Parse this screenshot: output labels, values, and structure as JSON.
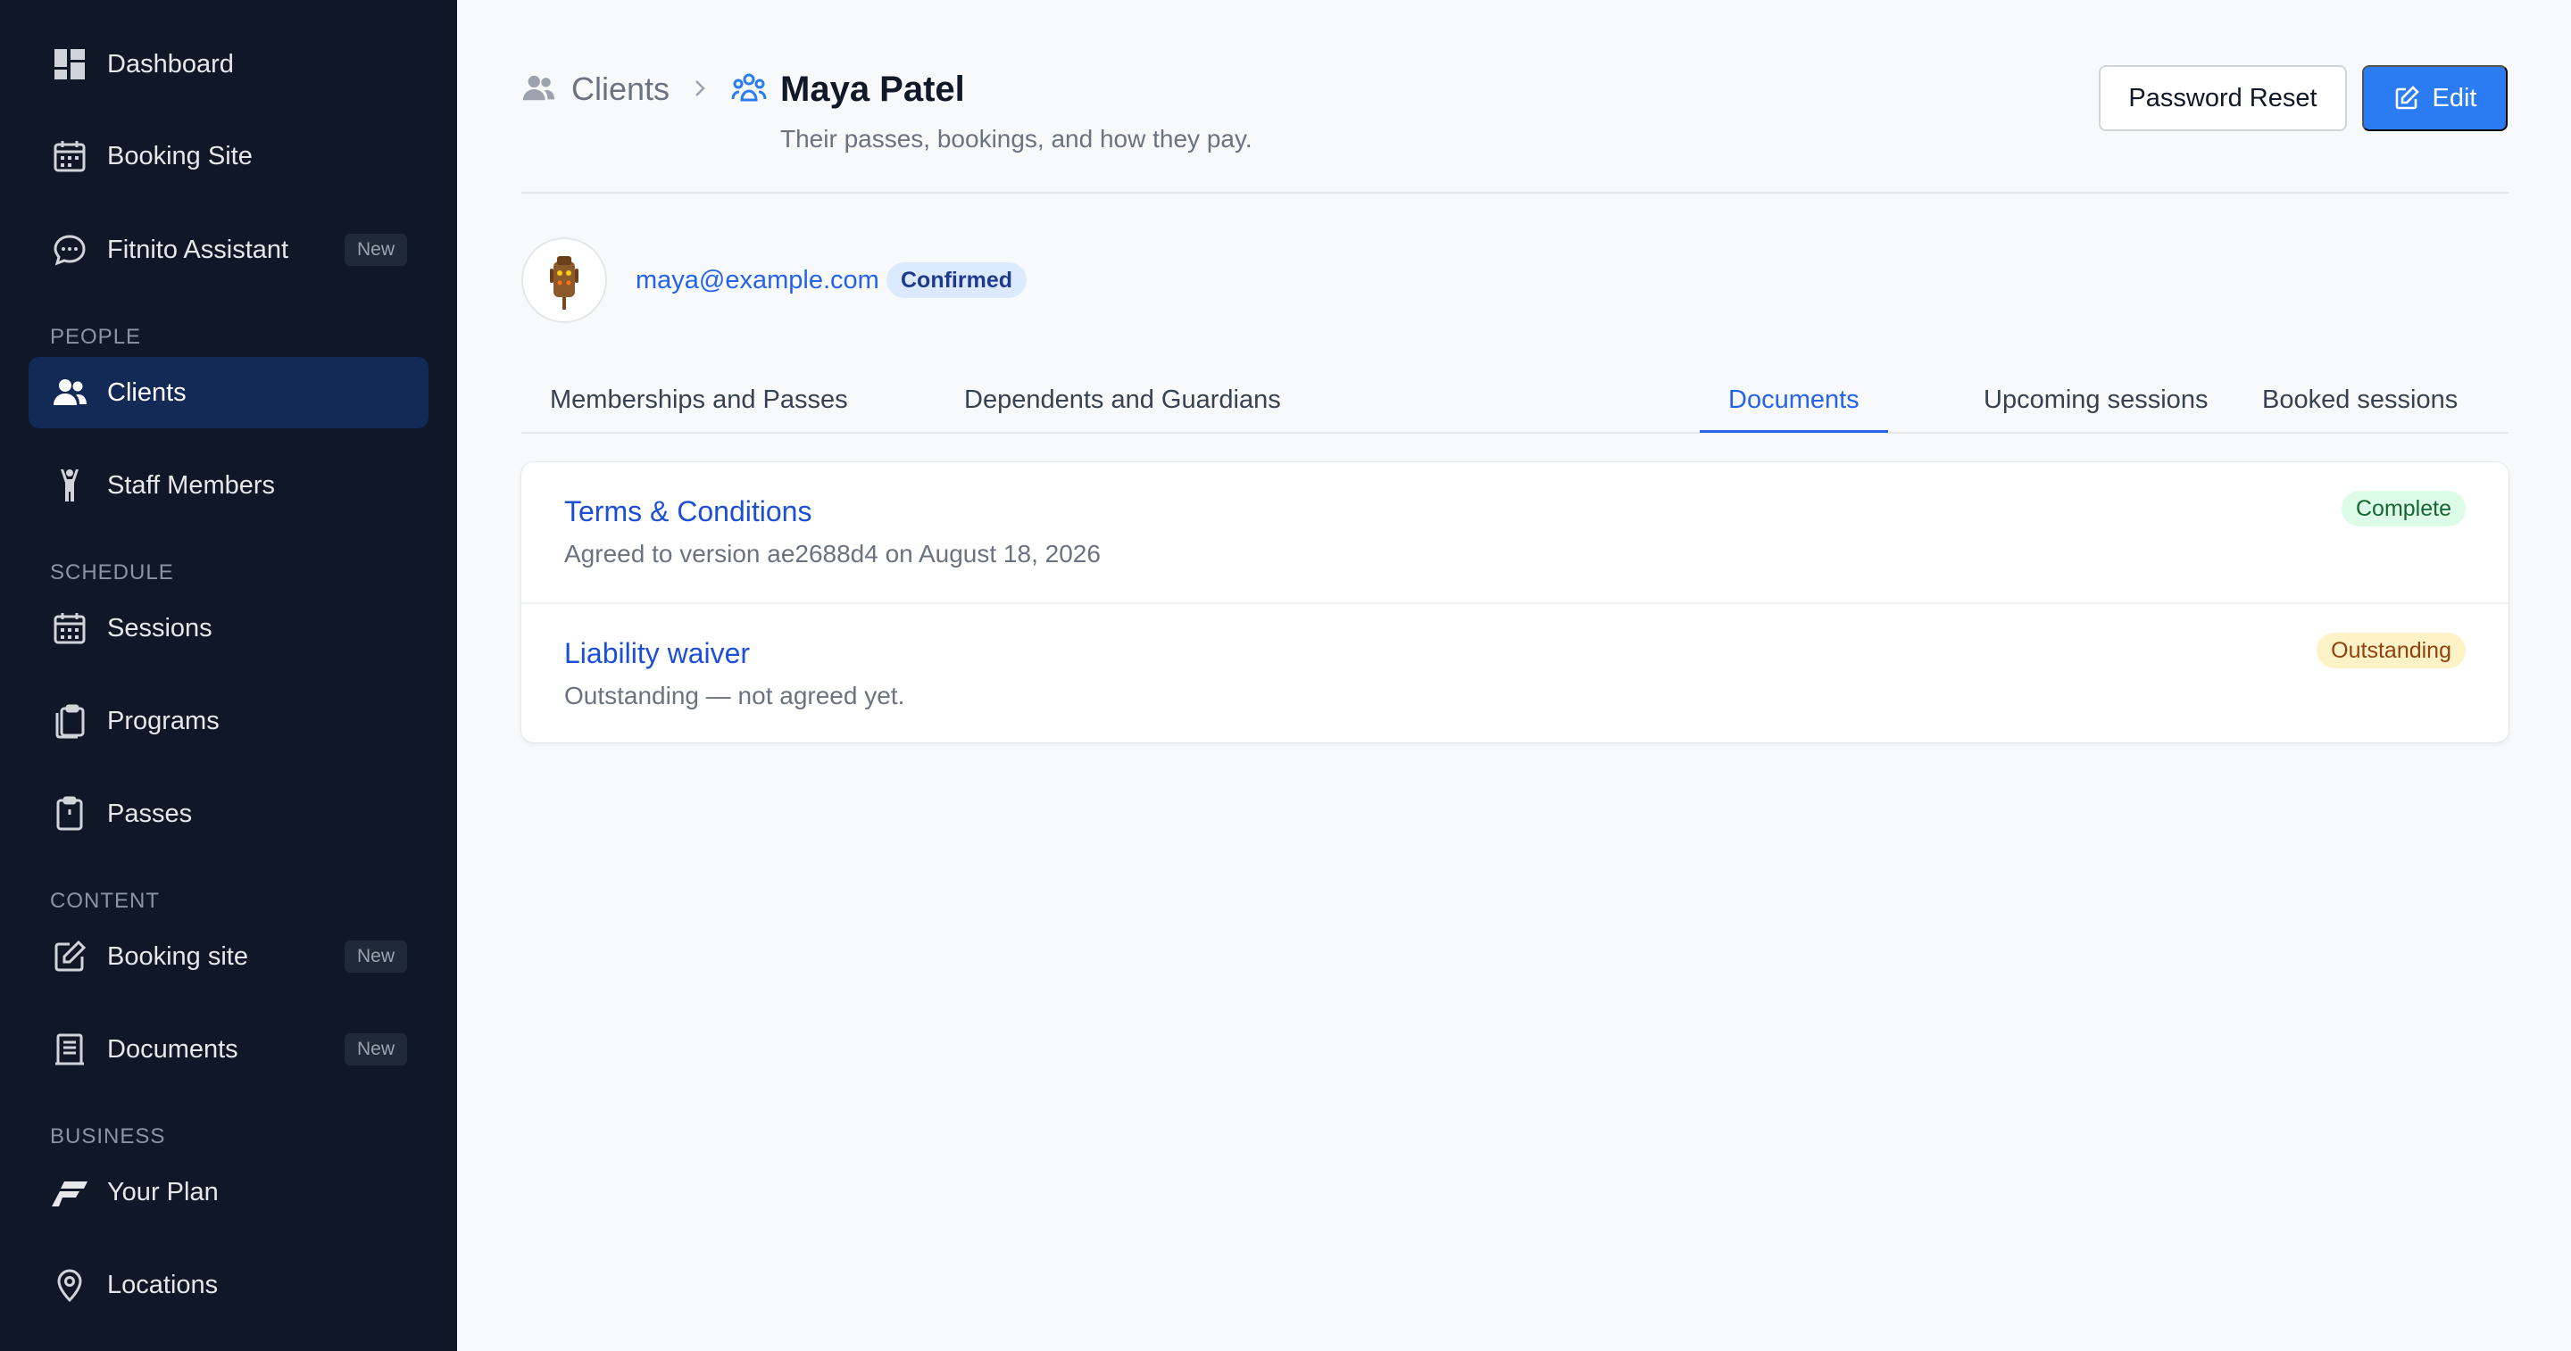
{
  "sidebar": {
    "items": [
      {
        "label": "Dashboard",
        "icon": "dashboard-icon"
      },
      {
        "label": "Booking Site",
        "icon": "calendar-icon"
      },
      {
        "label": "Fitnito Assistant",
        "icon": "chat-bubble-icon",
        "badge": "New"
      },
      {
        "label": "Clients",
        "icon": "users-icon",
        "active": true
      },
      {
        "label": "Staff Members",
        "icon": "staff-figure-icon"
      },
      {
        "label": "Sessions",
        "icon": "calendar-grid-icon"
      },
      {
        "label": "Programs",
        "icon": "clipboard-stack-icon"
      },
      {
        "label": "Passes",
        "icon": "clipboard-icon"
      },
      {
        "label": "Booking site",
        "icon": "edit-square-icon",
        "badge": "New"
      },
      {
        "label": "Documents",
        "icon": "document-icon",
        "badge": "New"
      },
      {
        "label": "Your Plan",
        "icon": "fitnito-logo-icon"
      },
      {
        "label": "Locations",
        "icon": "map-pin-icon"
      }
    ],
    "sections": {
      "people": "PEOPLE",
      "schedule": "SCHEDULE",
      "content": "CONTENT",
      "business": "BUSINESS"
    }
  },
  "header": {
    "breadcrumb_parent": "Clients",
    "title": "Maya Patel",
    "subtitle": "Their passes, bookings, and how they pay.",
    "password_reset_label": "Password Reset",
    "edit_label": "Edit"
  },
  "profile": {
    "email": "maya@example.com",
    "status": "Confirmed"
  },
  "tabs": [
    {
      "label": "Memberships and Passes"
    },
    {
      "label": "Dependents and Guardians"
    },
    {
      "label": "Documents",
      "active": true
    },
    {
      "label": "Upcoming sessions"
    },
    {
      "label": "Booked sessions"
    }
  ],
  "documents": [
    {
      "title": "Terms & Conditions",
      "description": "Agreed to version ae2688d4 on August 18, 2026",
      "status": "Complete"
    },
    {
      "title": "Liability waiver",
      "description": "Outstanding — not agreed yet.",
      "status": "Outstanding"
    }
  ],
  "colors": {
    "sidebar_bg": "#101828",
    "sidebar_active": "#132a56",
    "accent": "#2b7cf2",
    "link": "#2563eb",
    "complete_bg": "#dcfce7",
    "outstanding_bg": "#fef3c7"
  }
}
